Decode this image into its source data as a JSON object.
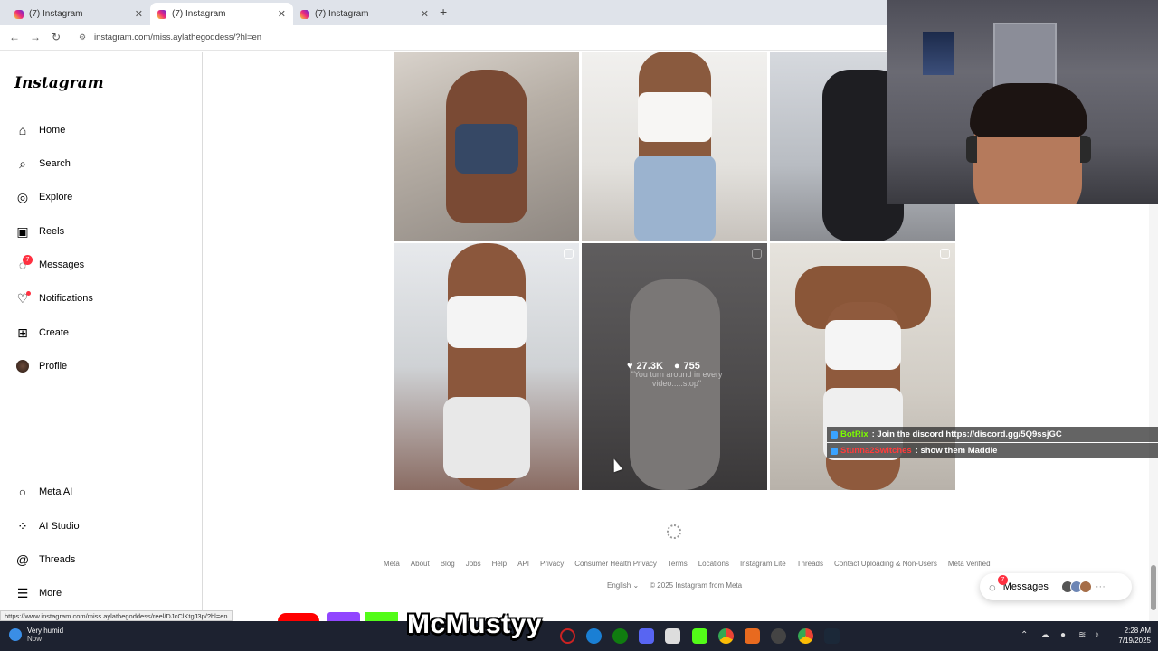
{
  "browser": {
    "tabs": [
      {
        "title": "(7) Instagram"
      },
      {
        "title": "(7) Instagram"
      },
      {
        "title": "(7) Instagram"
      }
    ],
    "url": "instagram.com/miss.aylathegoddess/?hl=en",
    "status_link": "https://www.instagram.com/miss.aylathegoddess/reel/DJcClKtgJ3p/?hl=en"
  },
  "sidebar": {
    "logo": "Instagram",
    "items": [
      {
        "label": "Home",
        "icon": "home-icon"
      },
      {
        "label": "Search",
        "icon": "search-icon"
      },
      {
        "label": "Explore",
        "icon": "compass-icon"
      },
      {
        "label": "Reels",
        "icon": "reels-icon"
      },
      {
        "label": "Messages",
        "icon": "messenger-icon",
        "badge": "7"
      },
      {
        "label": "Notifications",
        "icon": "heart-icon"
      },
      {
        "label": "Create",
        "icon": "plus-square-icon"
      },
      {
        "label": "Profile",
        "icon": "avatar"
      }
    ],
    "bottom_items": [
      {
        "label": "Meta AI",
        "icon": "meta-ai-icon"
      },
      {
        "label": "AI Studio",
        "icon": "ai-studio-icon"
      },
      {
        "label": "Threads",
        "icon": "threads-icon"
      },
      {
        "label": "More",
        "icon": "hamburger-icon"
      }
    ]
  },
  "grid": {
    "hovered_post": {
      "likes": "27.3K",
      "comments": "755",
      "caption": "\"You turn around in every video.....stop\""
    }
  },
  "footer": {
    "links": [
      "Meta",
      "About",
      "Blog",
      "Jobs",
      "Help",
      "API",
      "Privacy",
      "Consumer Health Privacy",
      "Terms",
      "Locations",
      "Instagram Lite",
      "Threads",
      "Contact Uploading & Non-Users",
      "Meta Verified"
    ],
    "language": "English",
    "copyright": "© 2025 Instagram from Meta"
  },
  "messages_pill": {
    "label": "Messages",
    "badge": "7"
  },
  "chat": [
    {
      "user": "BotRix",
      "text": ": Join the discord https://discord.gg/5Q9ssjGC"
    },
    {
      "user": "Stunna2Switches",
      "text": ": show them Maddie"
    }
  ],
  "stream": {
    "name": "McMustyy"
  },
  "taskbar": {
    "weather_title": "Very humid",
    "weather_sub": "Now",
    "time": "2:28 AM",
    "date": "7/19/2025"
  },
  "colors": {
    "accent": "#ff3040",
    "twitch": "#9146ff",
    "kick": "#53fc18",
    "youtube": "#ff0000"
  }
}
